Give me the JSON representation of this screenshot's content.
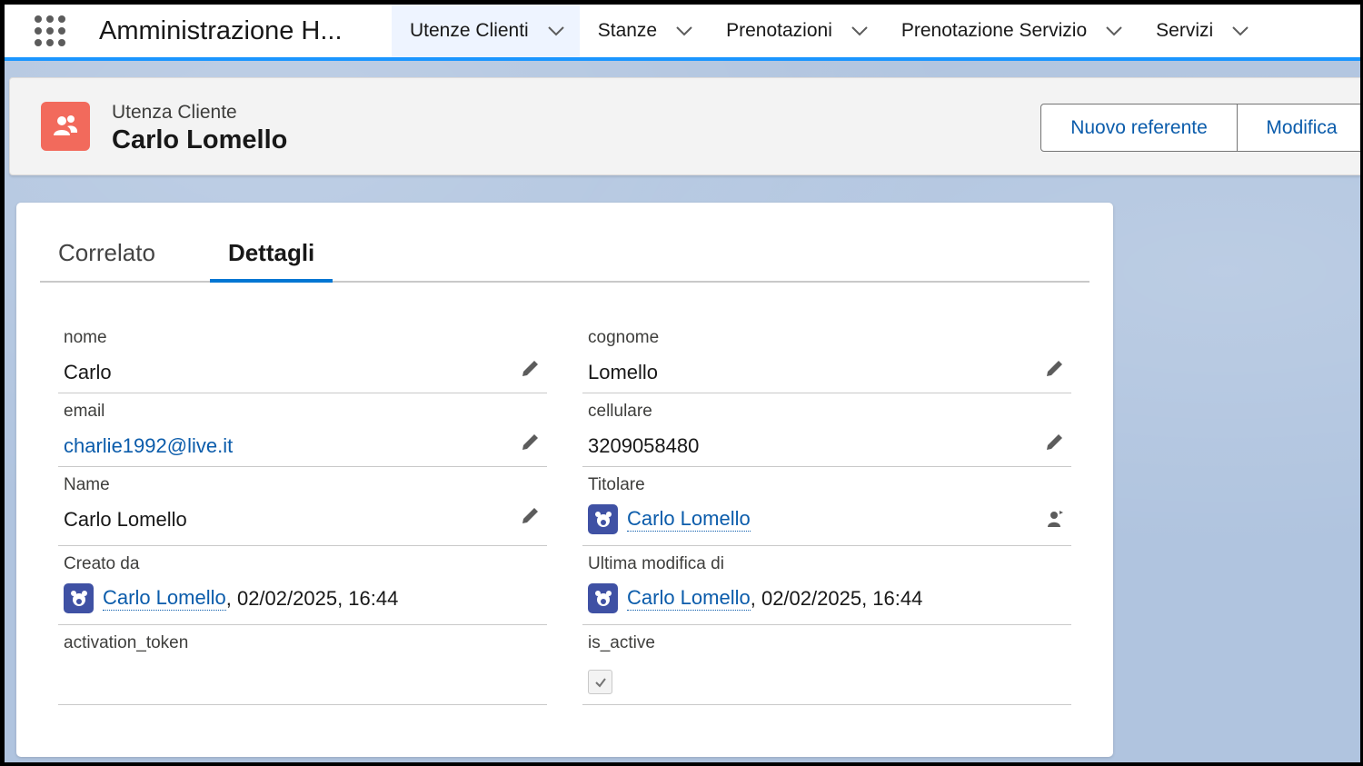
{
  "nav": {
    "app_name": "Amministrazione H...",
    "items": [
      {
        "label": "Utenze Clienti"
      },
      {
        "label": "Stanze"
      },
      {
        "label": "Prenotazioni"
      },
      {
        "label": "Prenotazione Servizio"
      },
      {
        "label": "Servizi"
      }
    ]
  },
  "record": {
    "type": "Utenza Cliente",
    "title": "Carlo Lomello",
    "buttons": {
      "new_contact": "Nuovo referente",
      "edit": "Modifica"
    }
  },
  "tabs": [
    {
      "label": "Correlato"
    },
    {
      "label": "Dettagli"
    }
  ],
  "fields": {
    "nome": {
      "label": "nome",
      "value": "Carlo"
    },
    "cognome": {
      "label": "cognome",
      "value": "Lomello"
    },
    "email": {
      "label": "email",
      "value": "charlie1992@live.it"
    },
    "cellulare": {
      "label": "cellulare",
      "value": "3209058480"
    },
    "name": {
      "label": "Name",
      "value": "Carlo Lomello"
    },
    "titolare": {
      "label": "Titolare",
      "value": "Carlo Lomello"
    },
    "creato_da": {
      "label": "Creato da",
      "user": "Carlo Lomello",
      "date": ", 02/02/2025, 16:44"
    },
    "ultima_modifica": {
      "label": "Ultima modifica di",
      "user": "Carlo Lomello",
      "date": ", 02/02/2025, 16:44"
    },
    "activation_token": {
      "label": "activation_token",
      "value": ""
    },
    "is_active": {
      "label": "is_active",
      "checked": true
    }
  },
  "colors": {
    "accent": "#0176d3",
    "link": "#0b5cab",
    "record_icon": "#f26a5c",
    "user_badge": "#3f51a4"
  }
}
